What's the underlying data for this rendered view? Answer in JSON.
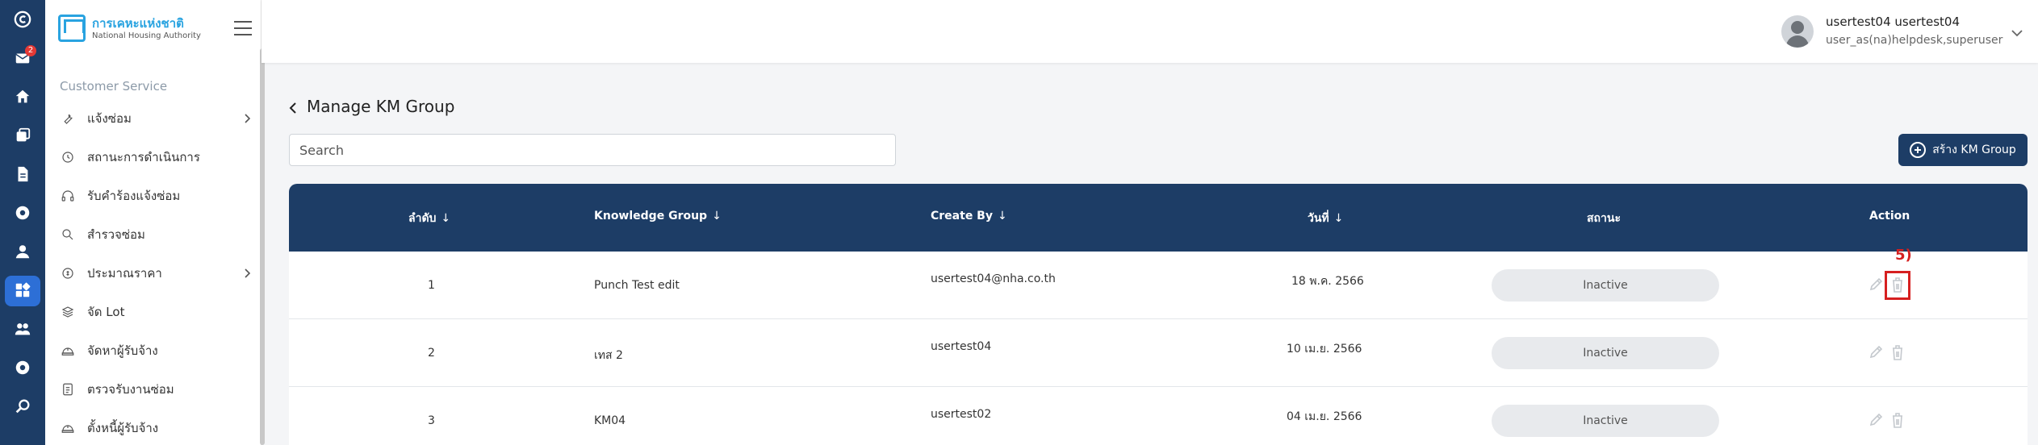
{
  "rail": {
    "mail_badge": "2",
    "items": [
      "logo-icon",
      "mail-icon",
      "home-icon",
      "layers-icon",
      "document-icon",
      "gear-icon",
      "user-icon",
      "dashboard-icon",
      "team-icon",
      "settings-icon",
      "search-icon"
    ]
  },
  "sidebar": {
    "logo_th": "การเคหะแห่งชาติ",
    "logo_en": "National Housing Authority",
    "section": "Customer Service",
    "items": [
      {
        "label": "แจ้งซ่อม",
        "icon": "wrench-icon",
        "expand": true
      },
      {
        "label": "สถานะการดำเนินการ",
        "icon": "history-icon",
        "expand": false
      },
      {
        "label": "รับคำร้องแจ้งซ่อม",
        "icon": "headset-icon",
        "expand": false
      },
      {
        "label": "สำรวจซ่อม",
        "icon": "search-icon",
        "expand": false
      },
      {
        "label": "ประมาณราคา",
        "icon": "coin-icon",
        "expand": true
      },
      {
        "label": "จัด Lot",
        "icon": "stack-icon",
        "expand": false
      },
      {
        "label": "จัดหาผู้รับจ้าง",
        "icon": "helmet-icon",
        "expand": false
      },
      {
        "label": "ตรวจรับงานซ่อม",
        "icon": "checklist-icon",
        "expand": false
      },
      {
        "label": "ตั้งหนี้ผู้รับจ้าง",
        "icon": "helmet-icon",
        "expand": false
      }
    ]
  },
  "header": {
    "user_name": "usertest04 usertest04",
    "user_role": "user_as(na)helpdesk,superuser"
  },
  "page": {
    "title": "Manage KM Group",
    "search_placeholder": "Search",
    "create_button": "สร้าง KM Group"
  },
  "table": {
    "columns": [
      "ลำดับ",
      "Knowledge Group",
      "Create By",
      "วันที่",
      "สถานะ",
      "Action"
    ],
    "sort_arrow": "↓",
    "rows": [
      {
        "no": "1",
        "group": "Punch Test edit",
        "created_by": "usertest04@nha.co.th",
        "date": "18 พ.ค. 2566",
        "status": "Inactive"
      },
      {
        "no": "2",
        "group": "เทส 2",
        "created_by": "usertest04",
        "date": "10 เม.ย. 2566",
        "status": "Inactive"
      },
      {
        "no": "3",
        "group": "KM04",
        "created_by": "usertest02",
        "date": "04 เม.ย. 2566",
        "status": "Inactive"
      }
    ]
  },
  "annotation": {
    "step": "5)",
    "color": "#d62020"
  },
  "colors": {
    "navy": "#1d3d66",
    "accent": "#2d6fd6",
    "brand": "#29a3e0"
  }
}
